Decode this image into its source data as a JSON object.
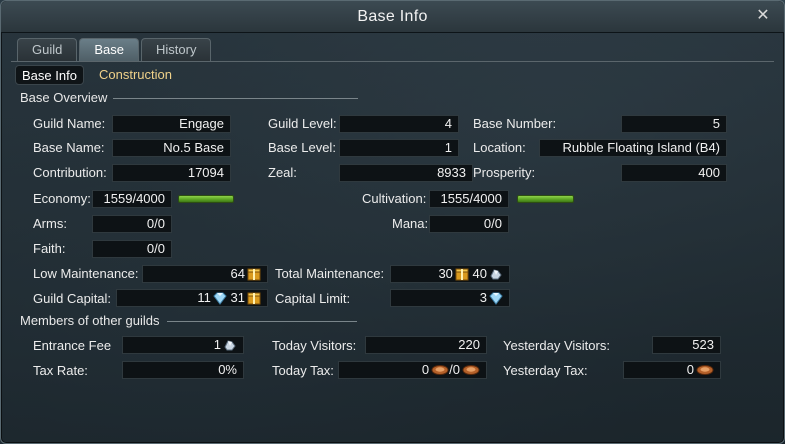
{
  "window": {
    "title": "Base Info"
  },
  "tabs": [
    {
      "label": "Guild"
    },
    {
      "label": "Base"
    },
    {
      "label": "History"
    }
  ],
  "subtabs": [
    {
      "label": "Base Info"
    },
    {
      "label": "Construction"
    }
  ],
  "base_overview": {
    "title": "Base Overview",
    "guild_name_label": "Guild Name:",
    "guild_name": "Engage",
    "guild_level_label": "Guild Level:",
    "guild_level": "4",
    "base_number_label": "Base Number:",
    "base_number": "5",
    "base_name_label": "Base Name:",
    "base_name": "No.5 Base",
    "base_level_label": "Base Level:",
    "base_level": "1",
    "location_label": "Location:",
    "location": "Rubble Floating Island (B4)",
    "contribution_label": "Contribution:",
    "contribution": "17094",
    "zeal_label": "Zeal:",
    "zeal": "8933",
    "prosperity_label": "Prosperity:",
    "prosperity": "400",
    "economy_label": "Economy:",
    "economy": "1559/4000",
    "economy_fraction": 0.39,
    "cultivation_label": "Cultivation:",
    "cultivation": "1555/4000",
    "cultivation_fraction": 0.39,
    "arms_label": "Arms:",
    "arms": "0/0",
    "mana_label": "Mana:",
    "mana": "0/0",
    "faith_label": "Faith:",
    "faith": "0/0",
    "low_maintenance_label": "Low Maintenance:",
    "low_maintenance": "64",
    "total_maintenance_label": "Total Maintenance:",
    "total_maintenance_a": "30",
    "total_maintenance_b": "40",
    "guild_capital_label": "Guild Capital:",
    "guild_capital_a": "11",
    "guild_capital_b": "31",
    "capital_limit_label": "Capital Limit:",
    "capital_limit": "3"
  },
  "members": {
    "title": "Members of other guilds",
    "entrance_fee_label": "Entrance Fee",
    "entrance_fee": "1",
    "today_visitors_label": "Today Visitors:",
    "today_visitors": "220",
    "yesterday_visitors_label": "Yesterday Visitors:",
    "yesterday_visitors": "523",
    "tax_rate_label": "Tax Rate:",
    "tax_rate": "0%",
    "today_tax_label": "Today Tax:",
    "today_tax_a": "0",
    "today_tax_sep": "/",
    "today_tax_b": "0",
    "yesterday_tax_label": "Yesterday Tax:",
    "yesterday_tax": "0"
  },
  "colors": {
    "accent_text": "#f0d28a",
    "bar_fill": "#5da624",
    "field_bg": "#0d1215"
  },
  "icons": [
    "close-icon",
    "gold-box-icon",
    "silver-ore-icon",
    "diamond-icon",
    "coin-plate-icon"
  ]
}
